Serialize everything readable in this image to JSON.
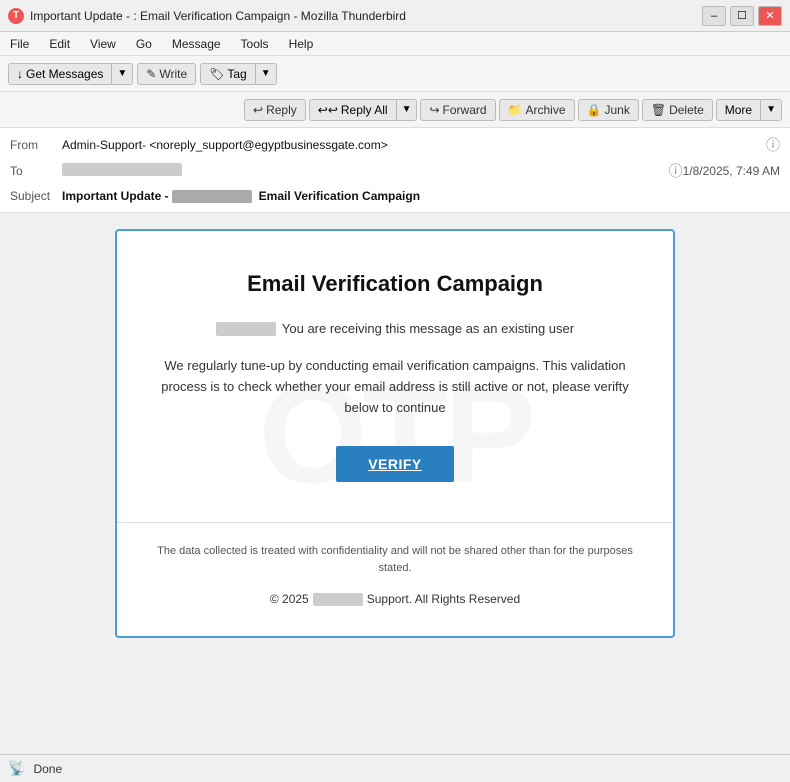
{
  "window": {
    "title": "Important Update -          : Email Verification Campaign - Mozilla Thunderbird"
  },
  "menu": {
    "items": [
      "File",
      "Edit",
      "View",
      "Go",
      "Message",
      "Tools",
      "Help"
    ]
  },
  "toolbar": {
    "get_messages_label": "Get Messages",
    "write_label": "Write",
    "tag_label": "Tag"
  },
  "action_toolbar": {
    "reply_label": "Reply",
    "reply_all_label": "Reply All",
    "forward_label": "Forward",
    "archive_label": "Archive",
    "junk_label": "Junk",
    "delete_label": "Delete",
    "more_label": "More"
  },
  "email_header": {
    "from_label": "From",
    "from_value": "Admin-Support-     <noreply_support@egyptbusinessgate.com>",
    "to_label": "To",
    "to_value": "",
    "date_value": "1/8/2025, 7:49 AM",
    "subject_label": "Subject",
    "subject_value": "Important Update -            Email Verification Campaign"
  },
  "email_body": {
    "title": "Email Verification Campaign",
    "greeting": "You are receiving this message as an existing user",
    "body_text": "We regularly tune-up by conducting email verification campaigns. This validation process is to check whether your email address is still active or not, please verifty below to continue",
    "verify_button": "VERIFY",
    "footer_text": "The data collected is treated with confidentiality and will not be shared  other  than for the purposes stated.",
    "copyright": "© 2025        Support. All Rights Reserved",
    "watermark": "OTP"
  },
  "status_bar": {
    "text": "Done"
  }
}
